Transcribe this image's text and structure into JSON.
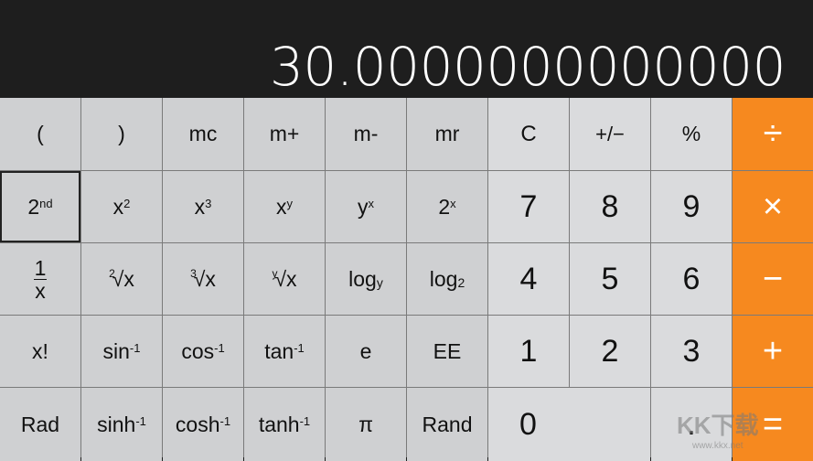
{
  "display": {
    "value": "30.0000000000000"
  },
  "keys": {
    "lparen": "(",
    "rparen": ")",
    "mc": "mc",
    "mplus": "m+",
    "mminus": "m-",
    "mr": "mr",
    "clear": "C",
    "sign": "+/−",
    "percent": "%",
    "divide": "÷",
    "second": {
      "base": "2",
      "sup": "nd"
    },
    "x2": {
      "base": "x",
      "sup": "2"
    },
    "x3": {
      "base": "x",
      "sup": "3"
    },
    "xy": {
      "base": "x",
      "sup": "y"
    },
    "yx": {
      "base": "y",
      "sup": "x"
    },
    "twox": {
      "base": "2",
      "sup": "x"
    },
    "seven": "7",
    "eight": "8",
    "nine": "9",
    "multiply": "×",
    "inv": {
      "num": "1",
      "den": "x"
    },
    "sqrt2": {
      "idx": "2",
      "body": "√x"
    },
    "sqrt3": {
      "idx": "3",
      "body": "√x"
    },
    "sqrty": {
      "idx": "y",
      "body": "√x"
    },
    "logy": {
      "base": "log",
      "sub": "y"
    },
    "log2": {
      "base": "log",
      "sub": "2"
    },
    "four": "4",
    "five": "5",
    "six": "6",
    "minus": "−",
    "fact": "x!",
    "asin": {
      "base": "sin",
      "sup": "-1"
    },
    "acos": {
      "base": "cos",
      "sup": "-1"
    },
    "atan": {
      "base": "tan",
      "sup": "-1"
    },
    "e": "e",
    "ee": "EE",
    "one": "1",
    "two": "2",
    "three": "3",
    "plus": "+",
    "rad": "Rad",
    "asinh": {
      "base": "sinh",
      "sup": "-1"
    },
    "acosh": {
      "base": "cosh",
      "sup": "-1"
    },
    "atanh": {
      "base": "tanh",
      "sup": "-1"
    },
    "pi": "π",
    "rand": "Rand",
    "zero": "0",
    "decimal": ".",
    "equals": "="
  },
  "colors": {
    "operator": "#f6891f",
    "function_key": "#cfd0d2",
    "number_key": "#dadbdd",
    "display_bg": "#1e1e1e"
  },
  "watermark": {
    "logo": "KK下载",
    "url": "www.kkx.net"
  }
}
